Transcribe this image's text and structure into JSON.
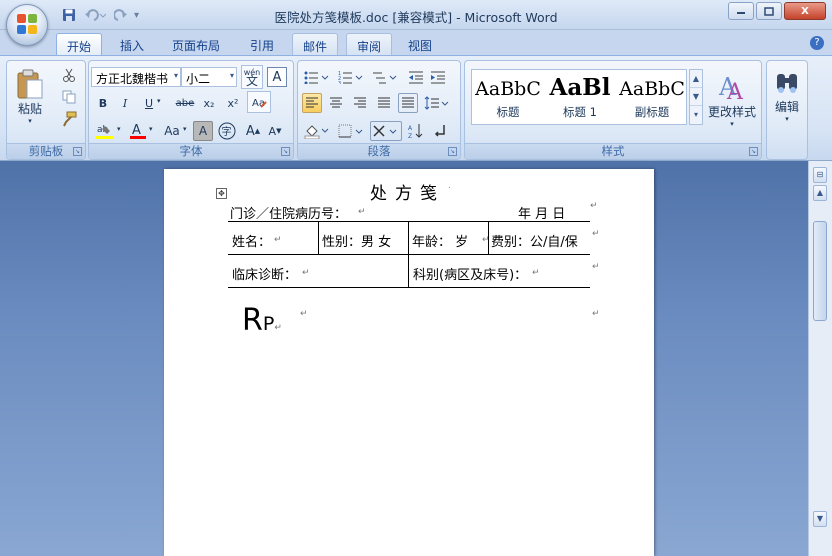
{
  "window": {
    "title": "医院处方笺模板.doc [兼容模式] - Microsoft Word",
    "minimize": "▭",
    "restore": "▢",
    "close": "X"
  },
  "qat": {
    "separator": "▾"
  },
  "tabs": [
    {
      "label": "开始",
      "active": true
    },
    {
      "label": "插入"
    },
    {
      "label": "页面布局"
    },
    {
      "label": "引用"
    },
    {
      "label": "邮件",
      "highlight": true
    },
    {
      "label": "审阅",
      "highlight": true
    },
    {
      "label": "视图"
    }
  ],
  "help": "?",
  "ribbon": {
    "clipboard": {
      "label": "剪贴板",
      "paste": "粘贴"
    },
    "font": {
      "label": "字体",
      "font_name": "方正北魏楷书",
      "font_size": "小二",
      "wen": "wén\n文",
      "bold": "B",
      "italic": "I",
      "underline": "U",
      "strike": "abe",
      "subscript": "x₂",
      "superscript": "x²",
      "change_case": "Aa",
      "grow": "A",
      "shrink": "A",
      "char_border": "A",
      "enclose": "字"
    },
    "paragraph": {
      "label": "段落"
    },
    "styles": {
      "label": "样式",
      "items": [
        {
          "sample": "AaBbC",
          "name": "标题"
        },
        {
          "sample": "AaBl",
          "name": "标题 1"
        },
        {
          "sample": "AaBbC",
          "name": "副标题"
        }
      ],
      "change_styles": "更改样式"
    },
    "editing": {
      "label": "编辑"
    }
  },
  "document": {
    "title": "处方笺",
    "row1_left": "门诊／住院病历号：",
    "row1_right": "年   月   日",
    "name_label": "姓名：",
    "gender_label": "性别：男   女",
    "age_label": "年龄：   岁",
    "fee_label": "费别：公/自/保",
    "diagnosis_label": "临床诊断：",
    "dept_label": "科别(病区及床号)：",
    "rp_big": "R",
    "rp_small": "P",
    "para_mark": "↵"
  },
  "colors": {
    "highlight": "#ffff00",
    "font_color": "#ff0000"
  }
}
